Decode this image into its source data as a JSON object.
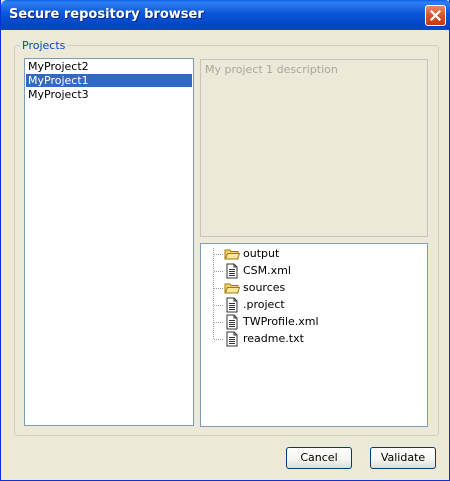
{
  "window": {
    "title": "Secure repository browser"
  },
  "projects_group": {
    "label": "Projects"
  },
  "project_list": {
    "items": [
      {
        "label": "MyProject2",
        "selected": false
      },
      {
        "label": "MyProject1",
        "selected": true
      },
      {
        "label": "MyProject3",
        "selected": false
      }
    ]
  },
  "description": {
    "text": "My project 1 description"
  },
  "file_tree": {
    "items": [
      {
        "label": "output",
        "icon": "folder-icon"
      },
      {
        "label": "CSM.xml",
        "icon": "file-icon"
      },
      {
        "label": "sources",
        "icon": "folder-icon"
      },
      {
        "label": ".project",
        "icon": "file-icon"
      },
      {
        "label": "TWProfile.xml",
        "icon": "file-icon"
      },
      {
        "label": "readme.txt",
        "icon": "file-icon"
      }
    ]
  },
  "buttons": {
    "cancel": "Cancel",
    "validate": "Validate"
  },
  "colors": {
    "titlebar": "#0a56d8",
    "selection": "#316ac5",
    "groupbox_label": "#0046d5",
    "window_bg": "#ece9d8"
  }
}
